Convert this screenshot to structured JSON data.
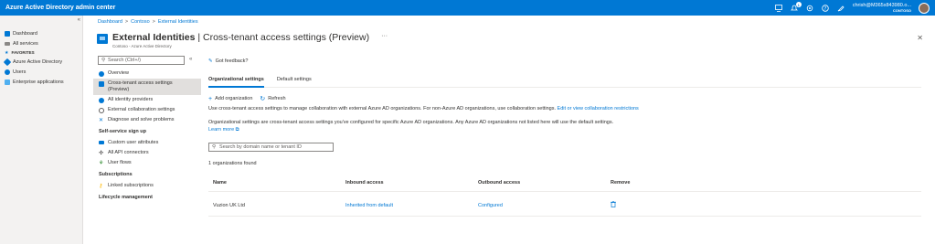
{
  "topbar": {
    "title": "Azure Active Directory admin center",
    "notification_count": "1",
    "account_email": "chrish@M365x843980.o...",
    "account_org": "CONTOSO"
  },
  "leftnav": {
    "collapse": "«",
    "items": [
      {
        "label": "Dashboard",
        "icon": "dashboard-icon"
      },
      {
        "label": "All services",
        "icon": "list-icon"
      },
      {
        "label": "FAVORITES",
        "icon": "star-icon"
      },
      {
        "label": "Azure Active Directory",
        "icon": "aad-icon"
      },
      {
        "label": "Users",
        "icon": "user-icon"
      },
      {
        "label": "Enterprise applications",
        "icon": "apps-icon"
      }
    ]
  },
  "breadcrumb": [
    "Dashboard",
    "Contoso",
    "External Identities"
  ],
  "header": {
    "title_bold": "External Identities",
    "title_rest": " | Cross-tenant access settings (Preview)",
    "subtitle": "Contoso - Azure Active Directory",
    "more": "···",
    "close": "✕"
  },
  "subnav": {
    "search_placeholder": "Search (Ctrl+/)",
    "collapse": "«",
    "items": [
      {
        "label": "Overview",
        "icon": "info-icon",
        "color": "#0078d4"
      },
      {
        "label": "Cross-tenant access settings (Preview)",
        "icon": "settings-monitor-icon",
        "color": "#0078d4"
      },
      {
        "label": "All identity providers",
        "icon": "identity-providers-icon",
        "color": "#0078d4"
      },
      {
        "label": "External collaboration settings",
        "icon": "gear-icon",
        "color": "#605e5c"
      },
      {
        "label": "Diagnose and solve problems",
        "icon": "wrench-icon",
        "color": "#0078d4"
      }
    ],
    "section1": "Self-service sign up",
    "items2": [
      {
        "label": "Custom user attributes",
        "icon": "attributes-icon",
        "color": "#0078d4"
      },
      {
        "label": "All API connectors",
        "icon": "api-connector-icon",
        "color": "#323130"
      },
      {
        "label": "User flows",
        "icon": "user-flows-icon",
        "color": "#107c10"
      }
    ],
    "section2": "Subscriptions",
    "items3": [
      {
        "label": "Linked subscriptions",
        "icon": "key-icon",
        "color": "#ffb900"
      }
    ],
    "section3": "Lifecycle management"
  },
  "content": {
    "feedback": "Got feedback?",
    "tabs": [
      "Organizational settings",
      "Default settings"
    ],
    "add_org": "Add organization",
    "refresh": "Refresh",
    "desc1": "Use cross-tenant access settings to manage collaboration with external Azure AD organizations. For non-Azure AD organizations, use collaboration settings.",
    "desc1_link": "Edit or view collaboration restrictions",
    "desc2": "Organizational settings are cross-tenant access settings you've configured for specific Azure AD organizations. Any Azure AD organizations not listed here will use the default settings.",
    "learn_more": "Learn more",
    "search_placeholder": "Search by domain name or tenant ID",
    "count": "1 organizations found",
    "columns": [
      "Name",
      "Inbound access",
      "Outbound access",
      "Remove"
    ],
    "rows": [
      {
        "name": "Vuzion UK Ltd",
        "inbound": "Inherited from default",
        "outbound": "Configured"
      }
    ]
  },
  "colors": {
    "accent": "#0078d4",
    "nav_bg": "#f3f2f1"
  }
}
